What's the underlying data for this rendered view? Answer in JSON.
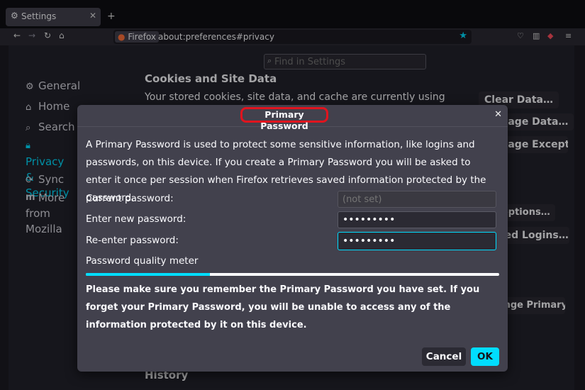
{
  "browser": {
    "tab_title": "Settings",
    "tab_icon": "gear-icon",
    "identity_label": "Firefox",
    "url": "about:preferences#privacy",
    "accent": "#00ddff"
  },
  "settings": {
    "search_placeholder": "Find in Settings",
    "categories": [
      {
        "label": "General",
        "icon": "gear-icon"
      },
      {
        "label": "Home",
        "icon": "home-icon"
      },
      {
        "label": "Search",
        "icon": "search-icon"
      },
      {
        "label": "Privacy & Security",
        "icon": "lock-icon"
      },
      {
        "label": "Sync",
        "icon": "sync-icon"
      },
      {
        "label": "More from Mozilla",
        "icon": "mozilla-icon"
      }
    ],
    "cookies_heading": "Cookies and Site Data",
    "cookies_text": "Your stored cookies, site data, and cache are currently using",
    "clear_data_button": "Clear Data…",
    "manage_data_button": "Manage Data…",
    "manage_exceptions_button": "Manage Exceptions…",
    "exceptions_button": "Exceptions…",
    "saved_logins_button": "Saved Logins…",
    "change_password_button": "Change Primary Password…",
    "history_heading": "History"
  },
  "dialog": {
    "title": "Primary Password",
    "description": "A Primary Password is used to protect some sensitive information, like logins and passwords, on this device. If you create a Primary Password you will be asked to enter it once per session when Firefox retrieves saved information protected by the password.",
    "current_label": "Current password:",
    "current_placeholder": "(not set)",
    "new_label": "Enter new password:",
    "new_value": "•••••••••",
    "reenter_label": "Re-enter password:",
    "reenter_value": "•••••••••",
    "meter_label": "Password quality meter",
    "meter_fraction": 0.3,
    "warning": "Please make sure you remember the Primary Password you have set. If you forget your Primary Password, you will be unable to access any of the information protected by it on this device.",
    "cancel_label": "Cancel",
    "ok_label": "OK",
    "title_highlight_color": "#e0141e"
  }
}
